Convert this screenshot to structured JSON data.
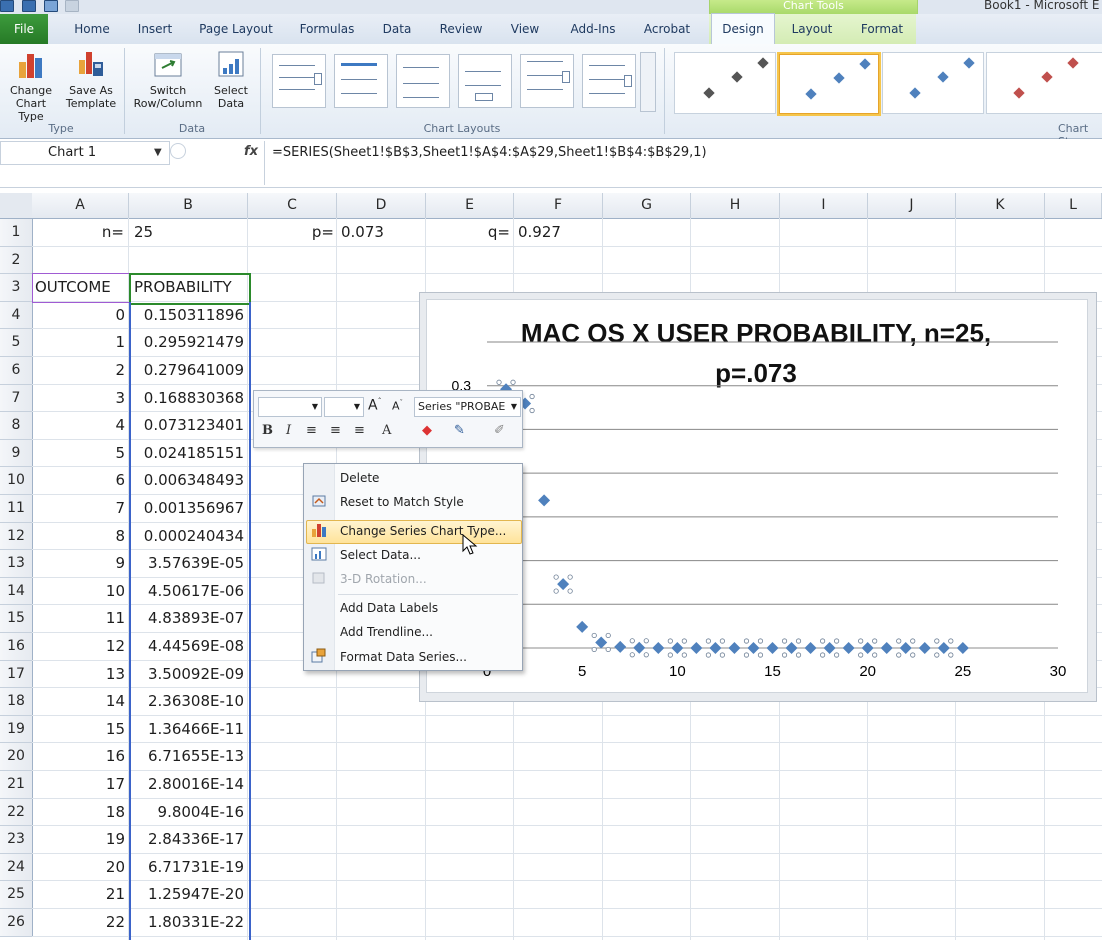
{
  "title_bar": {
    "context_label": "Chart Tools",
    "app_title": "Book1 - Microsoft E"
  },
  "tabs": [
    "File",
    "Home",
    "Insert",
    "Page Layout",
    "Formulas",
    "Data",
    "Review",
    "View",
    "Add-Ins",
    "Acrobat",
    "Design",
    "Layout",
    "Format"
  ],
  "ribbon": {
    "type_group": {
      "label": "Type",
      "change_chart_type": [
        "Change",
        "Chart Type"
      ],
      "save_as_template": [
        "Save As",
        "Template"
      ]
    },
    "data_group": {
      "label": "Data",
      "switch_row_column": [
        "Switch",
        "Row/Column"
      ],
      "select_data": [
        "Select",
        "Data"
      ]
    },
    "chart_layouts_label": "Chart Layouts",
    "chart_styles_label": "Chart St",
    "colors": {
      "style_gray": "#555555",
      "style_blue": "#4f81bd",
      "style_red": "#c0504d"
    }
  },
  "formula_bar": {
    "name_box": "Chart 1",
    "fx": "fx",
    "formula": "=SERIES(Sheet1!$B$3,Sheet1!$A$4:$A$29,Sheet1!$B$4:$B$29,1)"
  },
  "columns": [
    "A",
    "B",
    "C",
    "D",
    "E",
    "F",
    "G",
    "H",
    "I",
    "J",
    "K",
    "L"
  ],
  "row_numbers": [
    "1",
    "2",
    "3",
    "4",
    "5",
    "6",
    "7",
    "8",
    "9",
    "10",
    "11",
    "12",
    "13",
    "14",
    "15",
    "16",
    "17",
    "18",
    "19",
    "20",
    "21",
    "22",
    "23",
    "24",
    "25",
    "26"
  ],
  "sheet": {
    "n_label": "n=",
    "n_value": "25",
    "p_label": "p=",
    "p_value": "0.073",
    "q_label": "q=",
    "q_value": "0.927",
    "header_outcome": "OUTCOME",
    "header_probability": "PROBABILITY",
    "outcomes": [
      "0",
      "1",
      "2",
      "3",
      "4",
      "5",
      "6",
      "7",
      "8",
      "9",
      "10",
      "11",
      "12",
      "13",
      "14",
      "15",
      "16",
      "17",
      "18",
      "19",
      "20",
      "21",
      "22"
    ],
    "probabilities": [
      "0.150311896",
      "0.295921479",
      "0.279641009",
      "0.168830368",
      "0.073123401",
      "0.024185151",
      "0.006348493",
      "0.001356967",
      "0.000240434",
      "3.57639E-05",
      "4.50617E-06",
      "4.83893E-07",
      "4.44569E-08",
      "3.50092E-09",
      "2.36308E-10",
      "1.36466E-11",
      "6.71655E-13",
      "2.80016E-14",
      "9.8004E-16",
      "2.84336E-17",
      "6.71731E-19",
      "1.25947E-20",
      "1.80331E-22"
    ]
  },
  "mini_toolbar": {
    "series_selector": "Series \"PROBAE"
  },
  "context_menu": {
    "items": [
      "Delete",
      "Reset to Match Style",
      "Change Series Chart Type...",
      "Select Data...",
      "3-D Rotation...",
      "Add Data Labels",
      "Add Trendline...",
      "Format Data Series..."
    ],
    "highlighted": "Change Series Chart Type...",
    "disabled": "3-D Rotation..."
  },
  "chart_data": {
    "type": "scatter",
    "title": "MAC OS X USER PROBABILITY, n=25, p=.073",
    "title_lines": [
      "MAC OS X USER PROBABILITY, n=25,",
      "p=.073"
    ],
    "xlabel": "",
    "ylabel": "",
    "xlim": [
      0,
      30
    ],
    "ylim": [
      0,
      0.35
    ],
    "x_ticks": [
      "0",
      "5",
      "10",
      "15",
      "20",
      "25",
      "30"
    ],
    "y_tick_visible": "0.3",
    "gridlines": true,
    "legend": "none",
    "series_color": "#4f81bd",
    "x": [
      0,
      1,
      2,
      3,
      4,
      5,
      6,
      7,
      8,
      9,
      10,
      11,
      12,
      13,
      14,
      15,
      16,
      17,
      18,
      19,
      20,
      21,
      22,
      23,
      24,
      25
    ],
    "y": [
      0.150311896,
      0.295921479,
      0.279641009,
      0.168830368,
      0.073123401,
      0.024185151,
      0.006348493,
      0.001356967,
      0.000240434,
      3.57639e-05,
      4.50617e-06,
      4.83893e-07,
      4.44569e-08,
      3.50092e-09,
      2.36308e-10,
      1.36466e-11,
      6.71655e-13,
      2.80016e-14,
      9.8004e-16,
      2.84336e-17,
      6.71731e-19,
      1.25947e-20,
      1.80331e-22,
      0,
      0,
      0
    ]
  }
}
